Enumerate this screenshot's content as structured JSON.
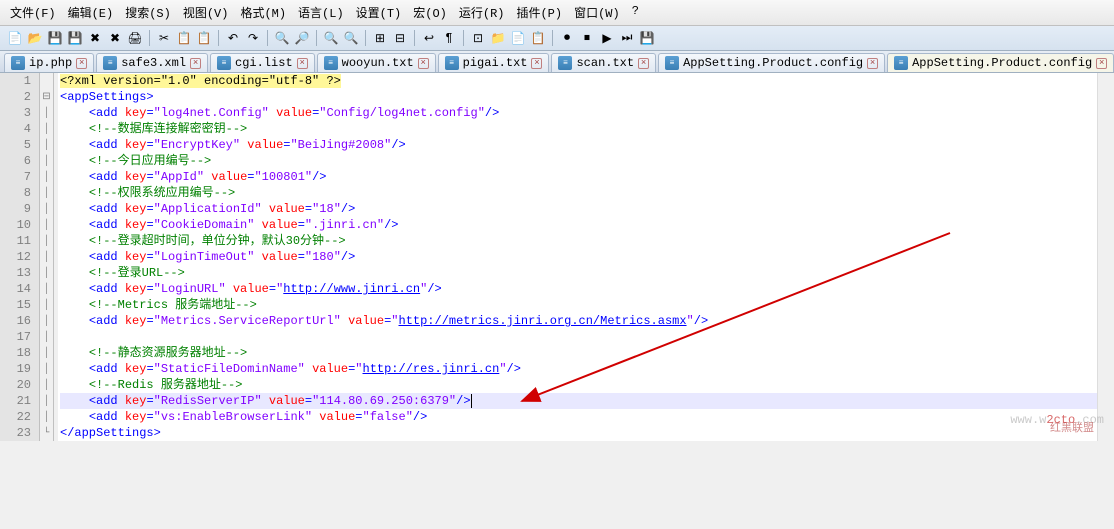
{
  "menu": {
    "file": "文件(F)",
    "edit": "编辑(E)",
    "search": "搜索(S)",
    "view": "视图(V)",
    "format": "格式(M)",
    "lang": "语言(L)",
    "settings": "设置(T)",
    "macro": "宏(O)",
    "run": "运行(R)",
    "plugins": "插件(P)",
    "window": "窗口(W)",
    "help": "?"
  },
  "tabs": [
    {
      "label": "ip.php"
    },
    {
      "label": "safe3.xml"
    },
    {
      "label": "cgi.list"
    },
    {
      "label": "wooyun.txt"
    },
    {
      "label": "pigai.txt"
    },
    {
      "label": "scan.txt"
    },
    {
      "label": "AppSetting.Product.config"
    },
    {
      "label": "AppSetting.Product.config"
    }
  ],
  "active_tab": 7,
  "xml_decl": "<?xml version=\"1.0\" encoding=\"utf-8\" ?>",
  "code": {
    "appSettings_open": "appSettings",
    "appSettings_close": "appSettings",
    "entries": [
      {
        "key": "log4net.Config",
        "value": "Config/log4net.config"
      },
      {
        "key": "EncryptKey",
        "value": "BeiJing#2008"
      },
      {
        "key": "AppId",
        "value": "100801"
      },
      {
        "key": "ApplicationId",
        "value": "18"
      },
      {
        "key": "CookieDomain",
        "value": ".jinri.cn"
      },
      {
        "key": "LoginTimeOut",
        "value": "180"
      },
      {
        "key": "LoginURL",
        "value": "http://www.jinri.cn"
      },
      {
        "key": "Metrics.ServiceReportUrl",
        "value": "http://metrics.jinri.org.cn/Metrics.asmx"
      },
      {
        "key": "StaticFileDominName",
        "value": "http://res.jinri.cn"
      },
      {
        "key": "RedisServerIP",
        "value": "114.80.69.250:6379"
      },
      {
        "key": "vs:EnableBrowserLink",
        "value": "false"
      }
    ],
    "comments": {
      "c1": "数据库连接解密密钥",
      "c2": "今日应用编号",
      "c3": "权限系统应用编号",
      "c4": "登录超时时间，单位分钟，默认30分钟",
      "c5": "登录URL",
      "c6": "Metrics 服务端地址",
      "c7": "静态资源服务器地址",
      "c8": "Redis 服务器地址"
    }
  },
  "watermark": {
    "prefix": "www.w",
    "mid": "2cto",
    "suffix": ".com",
    "sub": "红黑联盟"
  }
}
